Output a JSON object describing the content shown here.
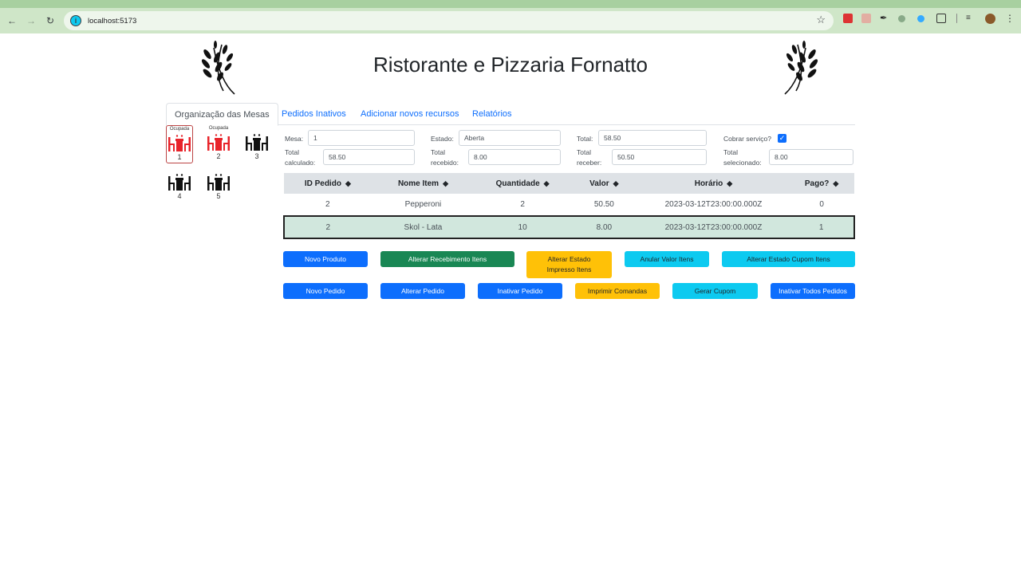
{
  "browser": {
    "url": "localhost:5173",
    "back_icon": "arrow-left-icon",
    "forward_icon": "arrow-right-icon",
    "reload_icon": "reload-icon"
  },
  "header": {
    "title": "Ristorante e Pizzaria Fornatto",
    "logo_icon": "wheat-icon"
  },
  "tabs": [
    {
      "label": "Organização das Mesas",
      "active": true
    },
    {
      "label": "Pedidos Inativos",
      "active": false
    },
    {
      "label": "Adicionar novos recursos",
      "active": false
    },
    {
      "label": "Relatórios",
      "active": false
    }
  ],
  "mesas": [
    {
      "num": "1",
      "status": "Ocupada",
      "occupied": true,
      "selected": true
    },
    {
      "num": "2",
      "status": "Ocupada",
      "occupied": true,
      "selected": false
    },
    {
      "num": "3",
      "status": "",
      "occupied": false,
      "selected": false
    },
    {
      "num": "4",
      "status": "",
      "occupied": false,
      "selected": false
    },
    {
      "num": "5",
      "status": "",
      "occupied": false,
      "selected": false
    }
  ],
  "form": {
    "mesa_label": "Mesa:",
    "mesa_value": "1",
    "estado_label": "Estado:",
    "estado_value": "Aberta",
    "total_label": "Total:",
    "total_value": "58.50",
    "cobrar_label": "Cobrar serviço?",
    "cobrar_checked": true,
    "total_calculado_label1": "Total",
    "total_calculado_label2": "calculado:",
    "total_calculado_value": "58.50",
    "total_recebido_label1": "Total",
    "total_recebido_label2": "recebido:",
    "total_recebido_value": "8.00",
    "total_receber_label1": "Total",
    "total_receber_label2": "receber:",
    "total_receber_value": "50.50",
    "total_selecionado_label1": "Total",
    "total_selecionado_label2": "selecionado:",
    "total_selecionado_value": "8.00"
  },
  "table": {
    "headers": [
      "ID Pedido",
      "Nome Item",
      "Quantidade",
      "Valor",
      "Horário",
      "Pago?"
    ],
    "rows": [
      {
        "id": "2",
        "nome": "Pepperoni",
        "qtd": "2",
        "valor": "50.50",
        "horario": "2023-03-12T23:00:00.000Z",
        "pago": "0",
        "selected": false
      },
      {
        "id": "2",
        "nome": "Skol - Lata",
        "qtd": "10",
        "valor": "8.00",
        "horario": "2023-03-12T23:00:00.000Z",
        "pago": "1",
        "selected": true
      }
    ]
  },
  "buttons_row1": {
    "novo_produto": "Novo Produto",
    "alterar_recebimento": "Alterar Recebimento Itens",
    "alterar_estado_impresso_1": "Alterar Estado",
    "alterar_estado_impresso_2": "Impresso Itens",
    "anular_valor": "Anular Valor Itens",
    "alterar_estado_cupom": "Alterar Estado Cupom Itens"
  },
  "buttons_row2": {
    "novo_pedido": "Novo Pedido",
    "alterar_pedido": "Alterar Pedido",
    "inativar_pedido": "Inativar Pedido",
    "imprimir_comandas": "Imprimir Comandas",
    "gerar_cupom": "Gerar Cupom",
    "inativar_todos": "Inativar Todos Pedidos"
  },
  "colors": {
    "primary": "#0d6efd",
    "success": "#198754",
    "warning": "#ffc107",
    "info": "#0dcaf0",
    "occupied": "#e8232a",
    "free": "#111111",
    "selected_row": "#d1e7dd"
  }
}
